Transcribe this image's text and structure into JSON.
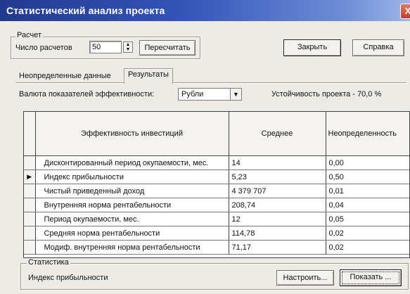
{
  "window": {
    "title": "Статистический анализ проекта",
    "close_glyph": "X"
  },
  "calc_group": {
    "caption": "Расчет",
    "count_label": "Число расчетов",
    "count_value": "50",
    "recalc_button": "Пересчитать"
  },
  "buttons": {
    "close": "Закрыть",
    "help": "Справка"
  },
  "tabs": [
    {
      "label": "Неопределенные данные",
      "active": false
    },
    {
      "label": "Результаты",
      "active": true
    }
  ],
  "currency": {
    "label": "Валюта показателей эффективности:",
    "selected": "Рубли"
  },
  "stability": "Устойчивость проекта -  70,0 %",
  "table": {
    "headers": [
      "Эффективность инвестиций",
      "Среднее",
      "Неопределенность"
    ],
    "rows": [
      {
        "name": "Дисконтированный период окупаемости, мес.",
        "mean": "14",
        "uncertainty": "0,00",
        "selected": false
      },
      {
        "name": "Индекс прибыльности",
        "mean": "5,23",
        "uncertainty": "0,50",
        "selected": true
      },
      {
        "name": "Чистый приведенный доход",
        "mean": "4 379 707",
        "uncertainty": "0,01",
        "selected": false
      },
      {
        "name": "Внутренняя норма рентабельности",
        "mean": "208,74",
        "uncertainty": "0,04",
        "selected": false
      },
      {
        "name": "Период окупаемости, мес.",
        "mean": "12",
        "uncertainty": "0,05",
        "selected": false
      },
      {
        "name": "Средняя норма рентабельности",
        "mean": "114,78",
        "uncertainty": "0,02",
        "selected": false
      },
      {
        "name": "Модиф. внутренняя норма рентабельности",
        "mean": "71,17",
        "uncertainty": "0,02",
        "selected": false
      }
    ]
  },
  "stats_group": {
    "caption": "Статистика",
    "current": "Индекс прибыльности",
    "configure_button": "Настроить...",
    "show_button": "Показать ..."
  }
}
